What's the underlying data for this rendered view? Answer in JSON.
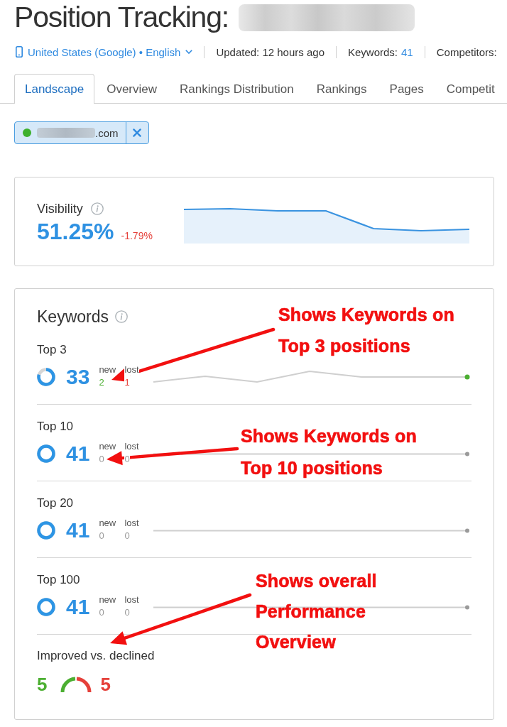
{
  "header": {
    "title": "Position Tracking:",
    "location": "United States (Google) • English",
    "updated": "Updated: 12 hours ago",
    "keywords_label": "Keywords:",
    "keywords_count": "41",
    "competitors_label": "Competitors:"
  },
  "tabs": [
    {
      "label": "Landscape",
      "selected": true
    },
    {
      "label": "Overview",
      "selected": false
    },
    {
      "label": "Rankings Distribution",
      "selected": false
    },
    {
      "label": "Rankings",
      "selected": false
    },
    {
      "label": "Pages",
      "selected": false
    },
    {
      "label": "Competit",
      "selected": false
    }
  ],
  "domain_filter": {
    "label": ".com",
    "color": "#3db02d"
  },
  "visibility": {
    "label": "Visibility",
    "value": "51.25%",
    "change": "-1.79%"
  },
  "keywords": {
    "title": "Keywords",
    "rows": [
      {
        "label": "Top 3",
        "count": "33",
        "level": 0.8,
        "new_label": "new",
        "new_value": "2",
        "lost_label": "lost",
        "lost_value": "1",
        "changed": true,
        "kind": "varying"
      },
      {
        "label": "Top 10",
        "count": "41",
        "level": 1,
        "new_label": "new",
        "new_value": "0",
        "lost_label": "lost",
        "lost_value": "0",
        "changed": false,
        "kind": "flat"
      },
      {
        "label": "Top 20",
        "count": "41",
        "level": 1,
        "new_label": "new",
        "new_value": "0",
        "lost_label": "lost",
        "lost_value": "0",
        "changed": false,
        "kind": "flat"
      },
      {
        "label": "Top 100",
        "count": "41",
        "level": 1,
        "new_label": "new",
        "new_value": "0",
        "lost_label": "lost",
        "lost_value": "0",
        "changed": false,
        "kind": "flat"
      }
    ],
    "improved": {
      "label": "Improved vs. declined",
      "improved": "5",
      "declined": "5",
      "level": 0.5
    }
  },
  "annotations": [
    {
      "lines": [
        "Shows Keywords on",
        "Top 3 positions"
      ]
    },
    {
      "lines": [
        "Shows Keywords on",
        "Top 10 positions"
      ]
    },
    {
      "lines": [
        "Shows overall",
        "Performance",
        "Overview"
      ]
    }
  ]
}
